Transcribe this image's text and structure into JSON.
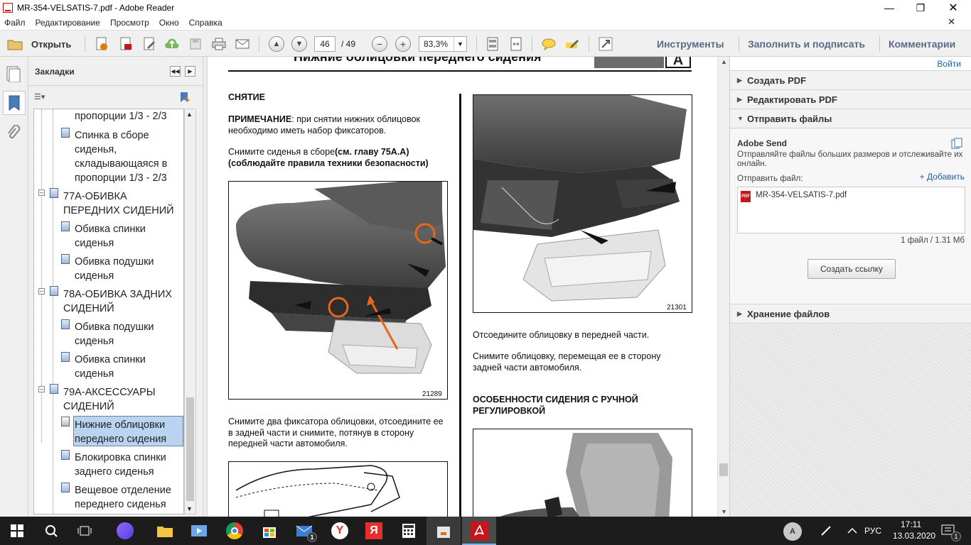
{
  "window": {
    "title": "MR-354-VELSATIS-7.pdf - Adobe Reader"
  },
  "menu": [
    "Файл",
    "Редактирование",
    "Просмотр",
    "Окно",
    "Справка"
  ],
  "toolbar": {
    "open_label": "Открыть",
    "page_current": "46",
    "page_total": "/ 49",
    "zoom": "83,3%",
    "tools_label": "Инструменты",
    "fill_sign_label": "Заполнить и подписать",
    "comments_label": "Комментарии"
  },
  "bookmarks": {
    "title": "Закладки",
    "items": [
      {
        "text": "пропорции 1/3 - 2/3"
      },
      {
        "text": "Спинка в сборе сиденья, складывающаяся в пропорции 1/3 - 2/3"
      },
      {
        "text": "77A-ОБИВКА ПЕРЕДНИХ СИДЕНИЙ"
      },
      {
        "text": "Обивка спинки сиденья"
      },
      {
        "text": "Обивка подушки сиденья"
      },
      {
        "text": "78A-ОБИВКА ЗАДНИХ СИДЕНИЙ"
      },
      {
        "text": "Обивка подушки сиденья"
      },
      {
        "text": "Обивка спинки сиденья"
      },
      {
        "text": "79A-АКСЕССУАРЫ СИДЕНИЙ"
      },
      {
        "text": "Нижние облицовки переднего сидения"
      },
      {
        "text": "Блокировка спинки заднего сиденья"
      },
      {
        "text": "Вещевое отделение переднего сиденья"
      }
    ]
  },
  "document": {
    "header": "Нижние облицовки переднего сидения",
    "header_code_letter": "A",
    "section_removal": "СНЯТИЕ",
    "note_label": "ПРИМЕЧАНИЕ",
    "note_text": ": при снятии нижних облицовок необходимо иметь набор фиксаторов.",
    "step1_text": "Снимите сиденья в сборе",
    "step1_bold": "(см. главу 75A.A) (соблюдайте правила техники безопасности)",
    "fig1_number": "21289",
    "step2_text": "Снимите два фиксатора облицовки, отсоедините ее в задней части и снимите, потянув в сторону передней части автомобиля.",
    "fig2_number": "21301",
    "step3_text": "Отсоедините облицовку в передней части.",
    "step4_text": "Снимите облицовку, перемещая ее в сторону задней части автомобиля.",
    "section_manual": "ОСОБЕННОСТИ СИДЕНИЯ С РУЧНОЙ РЕГУЛИРОВКОЙ"
  },
  "right_panel": {
    "signin": "Войти",
    "create_pdf": "Создать PDF",
    "edit_pdf": "Редактировать PDF",
    "send_files": "Отправить файлы",
    "adobe_send_title": "Adobe Send",
    "adobe_send_desc": "Отправляйте файлы больших размеров и отслеживайте их онлайн.",
    "send_file_label": "Отправить файл:",
    "add_link": "+ Добавить",
    "file_name": "MR-354-VELSATIS-7.pdf",
    "file_info": "1 файл / 1.31 Мб",
    "create_link_button": "Создать ссылку",
    "file_storage": "Хранение файлов"
  },
  "taskbar": {
    "user_initial": "A",
    "language": "РУС",
    "time": "17:11",
    "date": "13.03.2020",
    "notify_count": "1",
    "mail_badge": "1"
  },
  "colors": {
    "accent_orange": "#e8651a",
    "adobe_red": "#c4161c",
    "link_blue": "#1f5ea8"
  }
}
